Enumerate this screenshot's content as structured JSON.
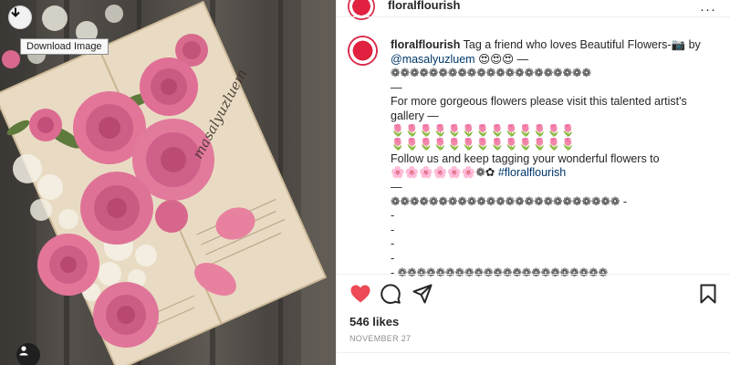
{
  "photo": {
    "download_tooltip": "Download Image",
    "watermark": "masalyuzluem",
    "icons": [
      "download-icon",
      "user-tag-icon"
    ]
  },
  "header": {
    "username": "floralflourish",
    "more_icon": "···"
  },
  "caption": {
    "username": "floralflourish",
    "lines": [
      "Tag a friend who loves Beautiful Flowers-📷 by",
      "@masalyuzluem",
      "😍😍😍 —",
      "❁❁❁❁❁❁❁❁❁❁❁❁❁❁❁❁❁❁❁❁❁",
      "—",
      "For more gorgeous flowers please visit this talented artist's",
      "gallery —",
      "🌷🌷🌷🌷🌷🌷🌷🌷🌷🌷🌷🌷🌷",
      "🌷🌷🌷🌷🌷🌷🌷🌷🌷🌷🌷🌷🌷",
      "Follow us and keep tagging your wonderful flowers to",
      "🌸🌸🌸🌸🌸🌸❁✿",
      "#floralflourish",
      "—",
      "❁❁❁❁❁❁❁❁❁❁❁❁❁❁❁❁❁❁❁❁❁❁❁❁ -",
      "-",
      "-",
      "-",
      "-",
      "- ❁❁❁❁❁❁❁❁❁❁❁❁❁❁❁❁❁❁❁❁❁❁"
    ]
  },
  "actions": {
    "icons": [
      "heart-icon",
      "comment-icon",
      "share-icon",
      "bookmark-icon"
    ],
    "liked_color": "#ed4956"
  },
  "likes": "546 likes",
  "date": "NOVEMBER 27"
}
